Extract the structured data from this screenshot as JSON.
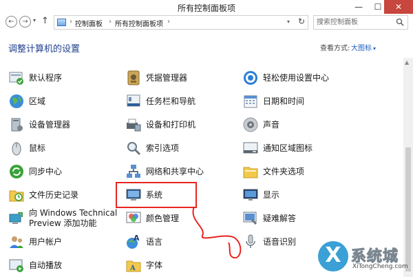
{
  "window": {
    "title": "所有控制面板项",
    "minimize_label": "—",
    "maximize_label": "☐",
    "close_label": "✕"
  },
  "nav": {
    "back_label": "←",
    "forward_label": "→",
    "dropdown_label": "▾",
    "up_label": "↑",
    "breadcrumb": [
      "控制面板",
      "所有控制面板项"
    ],
    "separator": "›",
    "address_dropdown": "▾",
    "refresh_label": "↻",
    "search_placeholder": "搜索控制面板"
  },
  "header": {
    "title": "调整计算机的设置",
    "view_by_label": "查看方式:",
    "view_by_value": "大图标",
    "view_by_arrow": "▾"
  },
  "items": [
    {
      "label": "默认程序",
      "icon": "default-programs-icon"
    },
    {
      "label": "凭据管理器",
      "icon": "credential-manager-icon"
    },
    {
      "label": "轻松使用设置中心",
      "icon": "ease-of-access-icon"
    },
    {
      "label": "区域",
      "icon": "region-icon"
    },
    {
      "label": "任务栏和导航",
      "icon": "taskbar-icon"
    },
    {
      "label": "日期和时间",
      "icon": "calendar-icon"
    },
    {
      "label": "设备管理器",
      "icon": "device-manager-icon"
    },
    {
      "label": "设备和打印机",
      "icon": "printer-icon"
    },
    {
      "label": "声音",
      "icon": "speaker-icon"
    },
    {
      "label": "鼠标",
      "icon": "mouse-icon"
    },
    {
      "label": "索引选项",
      "icon": "indexing-icon"
    },
    {
      "label": "通知区域图标",
      "icon": "notification-area-icon"
    },
    {
      "label": "同步中心",
      "icon": "sync-icon"
    },
    {
      "label": "网络和共享中心",
      "icon": "network-icon"
    },
    {
      "label": "文件夹选项",
      "icon": "folder-options-icon"
    },
    {
      "label": "文件历史记录",
      "icon": "file-history-icon"
    },
    {
      "label": "系统",
      "icon": "system-icon"
    },
    {
      "label": "显示",
      "icon": "display-icon"
    },
    {
      "label_line1": "向 Windows Technical",
      "label_line2": "Preview 添加功能",
      "icon": "add-features-icon"
    },
    {
      "label": "颜色管理",
      "icon": "color-management-icon"
    },
    {
      "label": "疑难解答",
      "icon": "troubleshooting-icon"
    },
    {
      "label": "用户帐户",
      "icon": "user-accounts-icon"
    },
    {
      "label": "语言",
      "icon": "language-icon"
    },
    {
      "label": "语音识别",
      "icon": "microphone-icon"
    },
    {
      "label": "自动播放",
      "icon": "autoplay-icon"
    },
    {
      "label": "字体",
      "icon": "fonts-icon"
    }
  ],
  "watermark": {
    "logo_letter": "X",
    "text": "系统城",
    "url": "XiTongCheng.com"
  },
  "colors": {
    "heading": "#1f3f8f",
    "link": "#1f5fbf",
    "close_button": "#c7463d",
    "annotation": "#e8231f"
  }
}
